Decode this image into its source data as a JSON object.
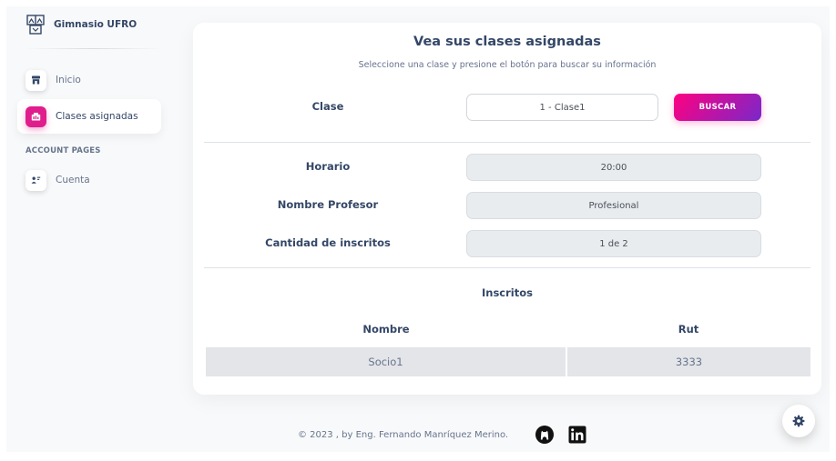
{
  "brand": {
    "name": "Gimnasio UFRO",
    "logo_icon": "gym-logo-icon"
  },
  "sidebar": {
    "items": [
      {
        "label": "Inicio",
        "icon": "shop-icon",
        "active": false
      },
      {
        "label": "Clases asignadas",
        "icon": "office-chart-icon",
        "active": true
      }
    ],
    "section_title": "ACCOUNT PAGES",
    "account_items": [
      {
        "label": "Cuenta",
        "icon": "user-account-icon",
        "active": false
      }
    ]
  },
  "main": {
    "title": "Vea sus clases asignadas",
    "subtitle": "Seleccione una clase y presione el botón para buscar su información",
    "clase": {
      "label": "Clase",
      "value": "1 - Clase1"
    },
    "search_button": "BUSCAR",
    "details": [
      {
        "label": "Horario",
        "value": "20:00"
      },
      {
        "label": "Nombre Profesor",
        "value": "Profesional"
      },
      {
        "label": "Cantidad de inscritos",
        "value": "1 de 2"
      }
    ],
    "inscritos": {
      "heading": "Inscritos",
      "columns": [
        "Nombre",
        "Rut"
      ],
      "rows": [
        [
          "Socio1",
          "3333"
        ]
      ]
    }
  },
  "footer": {
    "text": "© 2023 , by Eng. Fernando Manríquez Merino.",
    "links": [
      "github-icon",
      "linkedin-icon"
    ]
  },
  "settings_fab": {
    "icon": "gear-icon"
  },
  "colors": {
    "accent": "#e01d8c",
    "gradient_start": "#7928ca",
    "gradient_end": "#ff0080",
    "heading": "#344767",
    "muted": "#67748e"
  }
}
